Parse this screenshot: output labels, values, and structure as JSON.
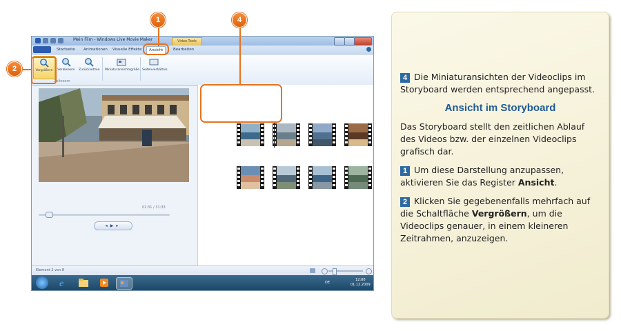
{
  "window": {
    "title": "Mein Film - Windows Live Movie Maker",
    "contextual_tab": "Video-Tools"
  },
  "tabs": [
    {
      "label": "Startseite"
    },
    {
      "label": "Animationen"
    },
    {
      "label": "Visuelle Effekte"
    },
    {
      "label": "Ansicht"
    },
    {
      "label": "Bearbeiten"
    }
  ],
  "ribbon": {
    "zoom_in": "Vergrößern",
    "zoom_out": "Verkleinern",
    "reset": "Zurücksetzen",
    "thumb_size": "Miniaturansichtsgröße",
    "aspect": "Seitenverhältnis",
    "group_label": "Zeitzoom"
  },
  "player": {
    "timecode": "01:31 / 31:33",
    "seek_progress": 0.05
  },
  "status": {
    "text": "Element 2 von 8"
  },
  "taskbar": {
    "lang": "DE",
    "time": "12:00",
    "date": "01.12.2009"
  },
  "callouts": {
    "c1": "1",
    "c2": "2",
    "c4": "4"
  },
  "panel": {
    "p4_num": "4",
    "p4_text": "Die Miniaturansichten der Videoclips im Storyboard werden entsprechend angepasst.",
    "heading": "Ansicht im Storyboard",
    "intro": "Das Storyboard stellt den zeitlichen Ablauf des Videos bzw. der einzelnen Videoclips grafisch dar.",
    "p1_num": "1",
    "p1_pre": "Um diese Darstellung anzupassen, aktivieren Sie das Register ",
    "p1_bold": "Ansicht",
    "p1_post": ".",
    "p2_num": "2",
    "p2_pre": "Klicken Sie gegebenenfalls mehrfach auf die Schaltfläche ",
    "p2_bold": "Vergrößern",
    "p2_post": ", um die Videoclips genauer, in einem kleineren Zeitrahmen, anzuzeigen."
  },
  "colors": {
    "accent_orange": "#e8721c",
    "number_blue": "#2d6aa3",
    "heading_blue": "#1f5b94"
  }
}
